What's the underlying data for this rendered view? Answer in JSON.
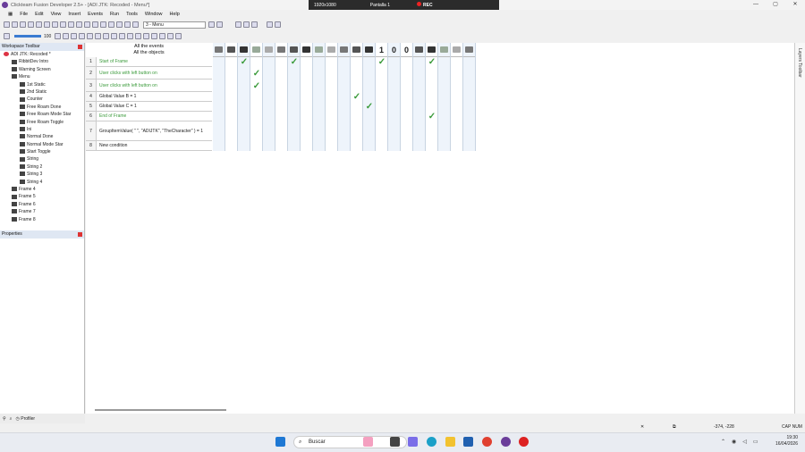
{
  "window": {
    "title": "Clickteam Fusion Developer 2.5+ - [ADI JTK: Recoded - Menu*]",
    "controls": [
      "—",
      "▢",
      "✕"
    ]
  },
  "recording_bar": {
    "resolution": "1920x1080",
    "screen": "Pantalla 1",
    "rec": "REC"
  },
  "menu": [
    "File",
    "Edit",
    "View",
    "Insert",
    "Events",
    "Run",
    "Tools",
    "Window",
    "Help"
  ],
  "toolbar": {
    "zoom": "100",
    "frame_select": "3 - Menu"
  },
  "workspace": {
    "title": "Workspace Toolbar",
    "items": [
      {
        "label": "ADI JTK: Recoded *",
        "indent": 0
      },
      {
        "label": "RibbitDev Intro",
        "indent": 1
      },
      {
        "label": "Warning Screen",
        "indent": 1
      },
      {
        "label": "Menu",
        "indent": 1
      },
      {
        "label": "1st Static",
        "indent": 2
      },
      {
        "label": "2nd Static",
        "indent": 2
      },
      {
        "label": "Counter",
        "indent": 2
      },
      {
        "label": "Free Roam Done",
        "indent": 2
      },
      {
        "label": "Free Roam Mode Star",
        "indent": 2
      },
      {
        "label": "Free Roam Toggle",
        "indent": 2
      },
      {
        "label": "Ini",
        "indent": 2
      },
      {
        "label": "Normal Done",
        "indent": 2
      },
      {
        "label": "Normal Mode Star",
        "indent": 2
      },
      {
        "label": "Start Toggle",
        "indent": 2
      },
      {
        "label": "String",
        "indent": 2
      },
      {
        "label": "String 2",
        "indent": 2
      },
      {
        "label": "String 3",
        "indent": 2
      },
      {
        "label": "String 4",
        "indent": 2
      },
      {
        "label": "Frame 4",
        "indent": 1
      },
      {
        "label": "Frame 5",
        "indent": 1
      },
      {
        "label": "Frame 6",
        "indent": 1
      },
      {
        "label": "Frame 7",
        "indent": 1
      },
      {
        "label": "Frame 8",
        "indent": 1
      }
    ]
  },
  "properties": {
    "title": "Properties"
  },
  "bottom_tabs": {
    "profiler": "Profiler"
  },
  "event_editor": {
    "header_line1": "All the events",
    "header_line2": "All the objects",
    "column_labels": [
      "1",
      "0",
      "0"
    ],
    "events": [
      {
        "num": "1",
        "text": "Start of Frame",
        "style": "green"
      },
      {
        "num": "2",
        "text": "User clicks with left button on",
        "style": "green"
      },
      {
        "num": "3",
        "text": "User clicks with left button on",
        "style": "green"
      },
      {
        "num": "4",
        "text": "Global Value B = 1",
        "style": "black"
      },
      {
        "num": "5",
        "text": "Global Value C = 1",
        "style": "black"
      },
      {
        "num": "6",
        "text": "End of Frame",
        "style": "green"
      },
      {
        "num": "7",
        "text": "GroupItemValue( \"  \", \"ADIJTK\", \"TheCharacter\" ) = 1",
        "style": "black"
      },
      {
        "num": "8",
        "text": "New condition",
        "style": "black"
      }
    ],
    "checks": [
      [
        1,
        2
      ],
      [
        1,
        6
      ],
      [
        1,
        13
      ],
      [
        1,
        17
      ],
      [
        2,
        3
      ],
      [
        3,
        3
      ],
      [
        4,
        11
      ],
      [
        5,
        12
      ],
      [
        6,
        17
      ]
    ]
  },
  "layers_toolbar": {
    "label": "Layers Toolbar"
  },
  "status": {
    "caps": "CAP NUM",
    "coords": "-374, -228"
  },
  "taskbar": {
    "search_placeholder": "Buscar",
    "time": "19:30",
    "date": "16/04/2026"
  }
}
